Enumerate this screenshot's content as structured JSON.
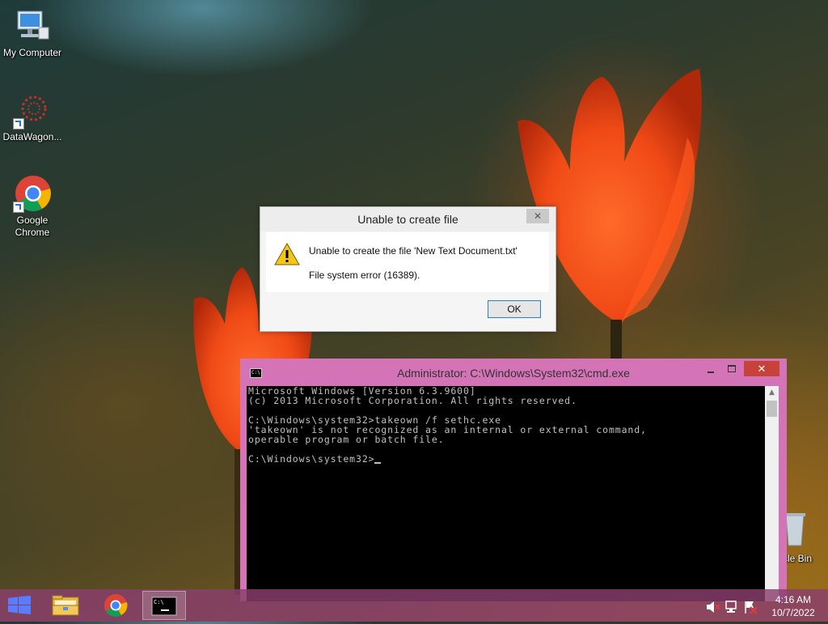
{
  "desktop": {
    "icons": [
      {
        "label": "My Computer",
        "icon": "computer-icon"
      },
      {
        "label": "DataWagon...",
        "icon": "datawagon-icon"
      },
      {
        "label": "Google Chrome",
        "icon": "chrome-icon"
      }
    ],
    "recycle_bin": {
      "label": "cle Bin",
      "icon": "recycle-bin-icon"
    }
  },
  "dialog": {
    "title": "Unable to create file",
    "close_label": "✕",
    "message": "Unable to create the file 'New Text Document.txt'",
    "detail": "File system error (16389).",
    "ok_label": "OK",
    "icon": "warning-icon"
  },
  "cmd": {
    "title": "Administrator: C:\\Windows\\System32\\cmd.exe",
    "close_label": "✕",
    "lines": [
      "Microsoft Windows [Version 6.3.9600]",
      "(c) 2013 Microsoft Corporation. All rights reserved.",
      "",
      "C:\\Windows\\system32>takeown /f sethc.exe",
      "'takeown' is not recognized as an internal or external command,",
      "operable program or batch file.",
      "",
      "C:\\Windows\\system32>"
    ],
    "colors": {
      "frame": "#d473b6",
      "close": "#c7423a",
      "text": "#c0c0c0",
      "background": "#000000"
    }
  },
  "taskbar": {
    "apps": [
      {
        "name": "file-explorer",
        "icon": "folder-icon",
        "active": false
      },
      {
        "name": "google-chrome",
        "icon": "chrome-icon",
        "active": false
      },
      {
        "name": "command-prompt",
        "icon": "cmd-icon",
        "active": true
      }
    ],
    "tray_icons": [
      "volume-muted-icon",
      "network-icon",
      "action-center-flag-icon"
    ],
    "time": "4:16 AM",
    "date": "10/7/2022",
    "color": "#8a3e6e"
  }
}
